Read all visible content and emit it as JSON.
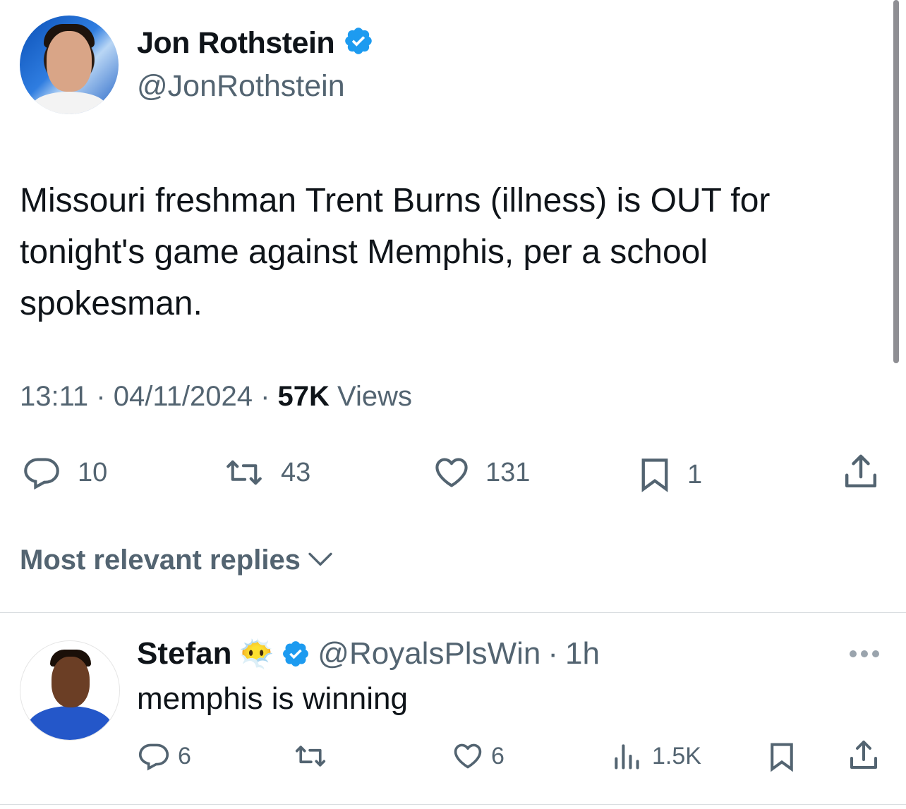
{
  "tweet": {
    "author_name": "Jon Rothstein",
    "author_handle": "@JonRothstein",
    "text": "Missouri freshman Trent Burns (illness) is OUT for tonight's game against Memphis, per a school spokesman.",
    "time": "13:11",
    "separator": "·",
    "date": "04/11/2024",
    "views_count": "57K",
    "views_label": "Views",
    "stats": {
      "replies": "10",
      "retweets": "43",
      "likes": "131",
      "bookmarks": "1"
    },
    "icons": [
      "reply-icon",
      "retweet-icon",
      "like-icon",
      "bookmark-icon",
      "share-icon",
      "verified-badge-icon"
    ]
  },
  "replies_filter": {
    "label": "Most relevant replies",
    "icon": "chevron-down-icon"
  },
  "reply": {
    "author_name": "Stefan",
    "author_emoji": "😶‍🌫️",
    "author_handle": "@RoyalsPlsWin",
    "separator": "·",
    "age": "1h",
    "text": "memphis is winning",
    "stats": {
      "replies": "6",
      "likes": "6",
      "views": "1.5K"
    },
    "icons": [
      "reply-icon",
      "retweet-icon",
      "like-icon",
      "views-icon",
      "bookmark-icon",
      "share-icon",
      "more-icon"
    ]
  },
  "colors": {
    "text_primary": "#0f1419",
    "text_secondary": "#536471",
    "verified_blue": "#1d9bf0",
    "divider": "#d9dde0"
  }
}
